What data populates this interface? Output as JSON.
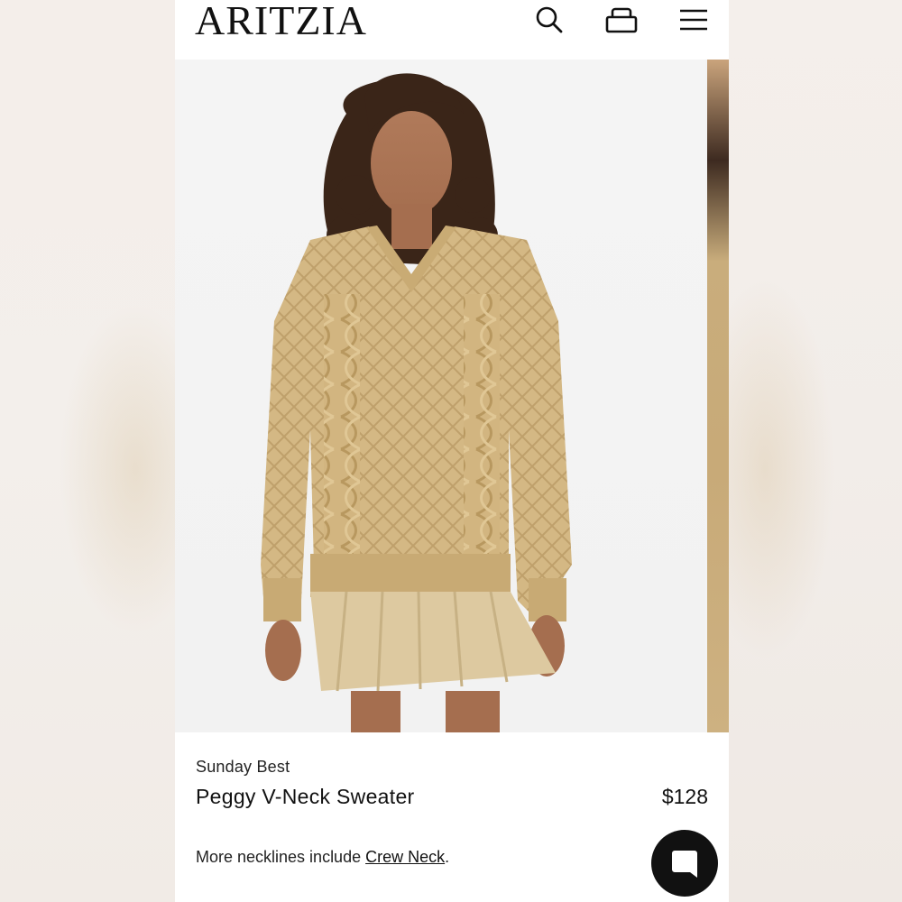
{
  "header": {
    "logo": "ARITZIA",
    "icons": [
      "search-icon",
      "shopping-bag-icon",
      "hamburger-menu-icon"
    ]
  },
  "product": {
    "brand": "Sunday Best",
    "name": "Peggy V-Neck Sweater",
    "price": "$128",
    "more_prefix": "More necklines include ",
    "more_link": "Crew Neck",
    "more_suffix": "."
  },
  "chat": {
    "icon": "chat-bubble-icon"
  },
  "colors": {
    "sweater": "#d4b884",
    "skirt": "#ddc9a0",
    "text": "#111111"
  }
}
